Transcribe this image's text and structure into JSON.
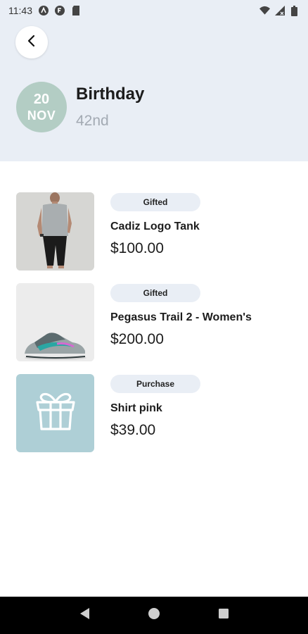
{
  "status_bar": {
    "time": "11:43",
    "left_icons": [
      "app-a-icon",
      "app-b-icon",
      "sd-card-icon"
    ],
    "right_icons": [
      "wifi-icon",
      "signal-icon",
      "battery-icon"
    ]
  },
  "header": {
    "back_icon": "chevron-left-icon",
    "date": {
      "day": "20",
      "month": "NOV"
    },
    "title": "Birthday",
    "subtitle": "42nd",
    "colors": {
      "background": "#e9eef5",
      "badge": "#b3cdc4"
    }
  },
  "items": [
    {
      "tag": "Gifted",
      "name": "Cadiz Logo Tank",
      "price": "$100.00",
      "image": "tank-top-photo"
    },
    {
      "tag": "Gifted",
      "name": "Pegasus Trail 2 - Women's",
      "price": "$200.00",
      "image": "running-shoe-photo"
    },
    {
      "tag": "Purchase",
      "name": "Shirt pink",
      "price": "$39.00",
      "image": "gift-box-icon"
    }
  ],
  "nav_bar": {
    "icons": [
      "back-triangle-icon",
      "home-circle-icon",
      "recents-square-icon"
    ]
  }
}
